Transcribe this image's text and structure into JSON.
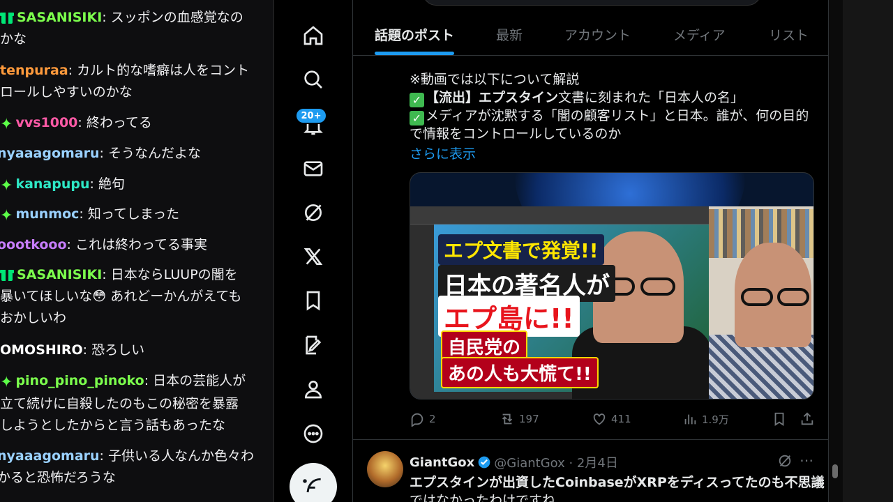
{
  "chat": {
    "messages": [
      {
        "badge": "gift",
        "user": "SASANISIKI",
        "user_color": "#7cff4d",
        "text": "スッポンの血感覚なの",
        "cont": "かな"
      },
      {
        "badge": "none",
        "user": "tenpuraa",
        "user_color": "#ff9a3c",
        "text": "カルト的な嗜癖は人をコント",
        "cont": "ロールしやすいのかな"
      },
      {
        "badge": "spark",
        "user": "vvs1000",
        "user_color": "#ff5aa6",
        "text": "終わってる",
        "cont": ""
      },
      {
        "badge": "none",
        "user": "nyaaagomaru",
        "user_color": "#9ad1ff",
        "text": "そうなんだよな",
        "cont": ""
      },
      {
        "badge": "spark",
        "user": "kanapupu",
        "user_color": "#2ee8c6",
        "text": "絶句",
        "cont": ""
      },
      {
        "badge": "spark",
        "user": "munmoc",
        "user_color": "#9ad1ff",
        "text": "知ってしまった",
        "cont": ""
      },
      {
        "badge": "none",
        "user": "oootkooo",
        "user_color": "#c77dff",
        "text": "これは終わってる事実",
        "cont": ""
      },
      {
        "badge": "gift",
        "user": "SASANISIKI",
        "user_color": "#7cff4d",
        "text": "日本ならLUUPの闇を",
        "cont": "暴いてほしいな😳 あれどーかんがえても",
        "cont2": "おかしいわ"
      },
      {
        "badge": "none",
        "user": "OMOSHIRO",
        "user_color": "#ffffff",
        "text": "恐ろしい",
        "cont": ""
      },
      {
        "badge": "spark",
        "user": "pino_pino_pinoko",
        "user_color": "#7cff4d",
        "text": "日本の芸能人が",
        "cont": "立て続けに自殺したのもこの秘密を暴露",
        "cont2": "しようとしたからと言う話もあったな"
      },
      {
        "badge": "none",
        "user": "nyaaagomaru",
        "user_color": "#9ad1ff",
        "text": "子供いる人なんか色々わ",
        "cont": "かると恐怖だろうな"
      }
    ]
  },
  "nav": {
    "notification_count": "20+",
    "icons": [
      "home-icon",
      "search-icon",
      "bell-icon",
      "mail-icon",
      "grok-icon",
      "x-logo-icon",
      "bookmark-icon",
      "premium-icon",
      "profile-icon",
      "more-icon"
    ]
  },
  "tabs": [
    "話題のポスト",
    "最新",
    "アカウント",
    "メディア",
    "リスト"
  ],
  "post1": {
    "line1": "※動画では以下について解説",
    "line2_bold": "【流出】エプスタイン",
    "line2_rest": "文書に刻まれた「日本人の名」",
    "line3": "メディアが沈黙する「闇の顧客リスト」と日本。誰が、何の目的",
    "line4": "で情報をコントロールしているのか",
    "show_more": "さらに表示",
    "media": {
      "caption1": "エプ文書で発覚!!",
      "caption2": "日本の著名人が",
      "caption3": "エプ島に!!",
      "caption4": "自民党の",
      "caption5": "あの人も大慌て!!"
    },
    "replies": "2",
    "reposts": "197",
    "likes": "411",
    "views": "1.9万"
  },
  "post2": {
    "name": "GiantGox",
    "handle": "@GiantGox · 2月4日",
    "text1": "エプスタインが出資したCoinbaseがXRPをディスってたのも不思議",
    "text2": "ではなかったわけですね"
  }
}
